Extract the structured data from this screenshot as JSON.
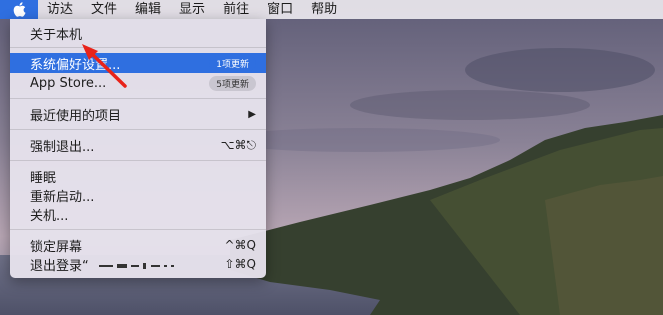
{
  "menubar": {
    "items": [
      "访达",
      "文件",
      "编辑",
      "显示",
      "前往",
      "窗口",
      "帮助"
    ]
  },
  "apple_menu": {
    "about": "关于本机",
    "system_prefs": "系统偏好设置...",
    "system_prefs_badge": "1项更新",
    "app_store": "App Store...",
    "app_store_badge": "5项更新",
    "recent_items": "最近使用的项目",
    "recent_items_arrow": "▶",
    "force_quit": "强制退出...",
    "force_quit_shortcut": "⌥⌘⎋",
    "sleep": "睡眠",
    "restart": "重新启动...",
    "shutdown": "关机...",
    "lock_screen": "锁定屏幕",
    "lock_screen_shortcut": "^⌘Q",
    "logout": "退出登录“",
    "logout_shortcut": "⇧⌘Q"
  },
  "colors": {
    "accent": "#2f6fe0",
    "annotation_arrow": "#e8231a"
  }
}
